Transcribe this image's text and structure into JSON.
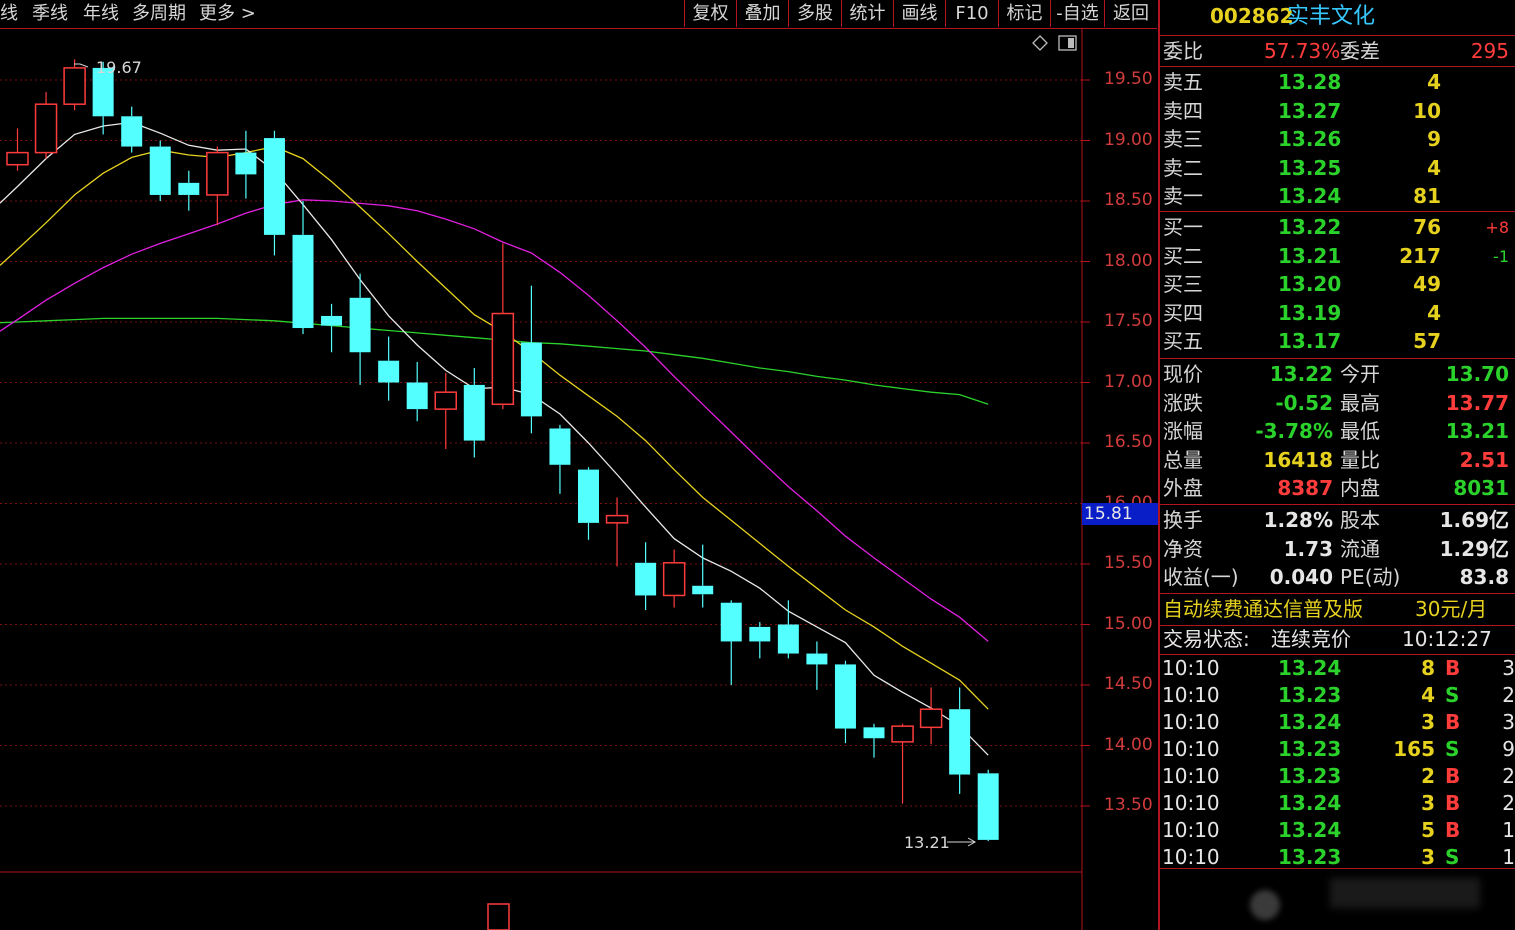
{
  "toolbar": {
    "period_tabs": [
      "线",
      "季线",
      "年线",
      "多周期",
      "更多"
    ],
    "more_arrow": ">",
    "buttons": [
      "复权",
      "叠加",
      "多股",
      "统计",
      "画线",
      "F10",
      "标记",
      "-自选",
      "返回"
    ]
  },
  "chart": {
    "y_ticks": [
      "19.50",
      "19.00",
      "18.50",
      "18.00",
      "17.50",
      "17.00",
      "16.50",
      "16.00",
      "15.50",
      "15.00",
      "14.50",
      "14.00",
      "13.50"
    ],
    "cursor_price": "15.81",
    "high_label": "19.67",
    "low_label": "13.21",
    "colors": {
      "up": "#ff3c3c",
      "down": "#54ffff",
      "ma5": "#e8e8e8",
      "ma10": "#e6d21e",
      "ma20": "#e020e0",
      "ma60": "#2bd22b",
      "grid": "#7a1010"
    },
    "candles": [
      {
        "o": 18.8,
        "c": 18.9,
        "h": 19.1,
        "l": 18.75
      },
      {
        "o": 18.9,
        "c": 19.3,
        "h": 19.4,
        "l": 18.85
      },
      {
        "o": 19.3,
        "c": 19.6,
        "h": 19.67,
        "l": 19.25
      },
      {
        "o": 19.6,
        "c": 19.2,
        "h": 19.65,
        "l": 19.05
      },
      {
        "o": 19.2,
        "c": 18.95,
        "h": 19.28,
        "l": 18.9
      },
      {
        "o": 18.95,
        "c": 18.55,
        "h": 19.0,
        "l": 18.5
      },
      {
        "o": 18.65,
        "c": 18.55,
        "h": 18.75,
        "l": 18.42
      },
      {
        "o": 18.55,
        "c": 18.9,
        "h": 18.95,
        "l": 18.3
      },
      {
        "o": 18.9,
        "c": 18.72,
        "h": 19.08,
        "l": 18.52
      },
      {
        "o": 19.02,
        "c": 18.22,
        "h": 19.08,
        "l": 18.05
      },
      {
        "o": 18.22,
        "c": 17.45,
        "h": 18.5,
        "l": 17.4
      },
      {
        "o": 17.55,
        "c": 17.47,
        "h": 17.65,
        "l": 17.25
      },
      {
        "o": 17.7,
        "c": 17.25,
        "h": 17.9,
        "l": 16.98
      },
      {
        "o": 17.18,
        "c": 17.0,
        "h": 17.38,
        "l": 16.85
      },
      {
        "o": 17.0,
        "c": 16.78,
        "h": 17.17,
        "l": 16.68
      },
      {
        "o": 16.78,
        "c": 16.92,
        "h": 17.08,
        "l": 16.45
      },
      {
        "o": 16.98,
        "c": 16.52,
        "h": 17.12,
        "l": 16.38
      },
      {
        "o": 16.82,
        "c": 17.57,
        "h": 18.15,
        "l": 16.78
      },
      {
        "o": 17.33,
        "c": 16.72,
        "h": 17.8,
        "l": 16.58
      },
      {
        "o": 16.62,
        "c": 16.32,
        "h": 16.65,
        "l": 16.08
      },
      {
        "o": 16.28,
        "c": 15.84,
        "h": 16.3,
        "l": 15.7
      },
      {
        "o": 15.84,
        "c": 15.9,
        "h": 16.05,
        "l": 15.48
      },
      {
        "o": 15.51,
        "c": 15.24,
        "h": 15.68,
        "l": 15.12
      },
      {
        "o": 15.24,
        "c": 15.51,
        "h": 15.62,
        "l": 15.14
      },
      {
        "o": 15.32,
        "c": 15.25,
        "h": 15.66,
        "l": 15.14
      },
      {
        "o": 15.18,
        "c": 14.86,
        "h": 15.2,
        "l": 14.5
      },
      {
        "o": 14.98,
        "c": 14.86,
        "h": 15.02,
        "l": 14.72
      },
      {
        "o": 15.0,
        "c": 14.76,
        "h": 15.2,
        "l": 14.72
      },
      {
        "o": 14.76,
        "c": 14.67,
        "h": 14.86,
        "l": 14.46
      },
      {
        "o": 14.67,
        "c": 14.14,
        "h": 14.7,
        "l": 14.02
      },
      {
        "o": 14.15,
        "c": 14.06,
        "h": 14.18,
        "l": 13.9
      },
      {
        "o": 14.03,
        "c": 14.16,
        "h": 14.18,
        "l": 13.52
      },
      {
        "o": 14.15,
        "c": 14.3,
        "h": 14.48,
        "l": 14.01
      },
      {
        "o": 14.3,
        "c": 13.76,
        "h": 14.48,
        "l": 13.6
      },
      {
        "o": 13.77,
        "c": 13.22,
        "h": 13.8,
        "l": 13.21
      }
    ],
    "ma5": [
      18.62,
      18.85,
      19.05,
      19.12,
      19.15,
      19.06,
      18.96,
      18.92,
      18.93,
      18.75,
      18.47,
      18.18,
      17.85,
      17.55,
      17.31,
      17.1,
      16.95,
      16.96,
      16.9,
      16.74,
      16.5,
      16.24,
      15.97,
      15.71,
      15.55,
      15.44,
      15.3,
      15.11,
      14.98,
      14.85,
      14.58,
      14.44,
      14.31,
      14.16,
      13.92
    ],
    "ma10": [
      18.1,
      18.32,
      18.55,
      18.73,
      18.86,
      18.92,
      18.88,
      18.86,
      18.9,
      18.95,
      18.85,
      18.66,
      18.45,
      18.23,
      18.0,
      17.78,
      17.56,
      17.42,
      17.25,
      17.06,
      16.89,
      16.72,
      16.52,
      16.28,
      16.05,
      15.86,
      15.67,
      15.48,
      15.3,
      15.12,
      14.98,
      14.82,
      14.68,
      14.54,
      14.3
    ],
    "ma20": [
      17.52,
      17.68,
      17.82,
      17.95,
      18.06,
      18.15,
      18.23,
      18.31,
      18.4,
      18.47,
      18.51,
      18.5,
      18.48,
      18.46,
      18.42,
      18.35,
      18.27,
      18.16,
      18.07,
      17.91,
      17.72,
      17.51,
      17.29,
      17.05,
      16.82,
      16.59,
      16.36,
      16.14,
      15.94,
      15.73,
      15.55,
      15.38,
      15.21,
      15.06,
      14.86
    ],
    "ma60": [
      17.5,
      17.51,
      17.52,
      17.53,
      17.53,
      17.53,
      17.53,
      17.53,
      17.52,
      17.51,
      17.49,
      17.47,
      17.45,
      17.43,
      17.41,
      17.39,
      17.37,
      17.35,
      17.33,
      17.32,
      17.3,
      17.28,
      17.26,
      17.23,
      17.2,
      17.16,
      17.12,
      17.09,
      17.05,
      17.02,
      16.98,
      16.95,
      16.92,
      16.9,
      16.82
    ]
  },
  "quote": {
    "code": "002862",
    "name": "实丰文化",
    "weibi_label": "委比",
    "weibi": "57.73%",
    "weicha_label": "委差",
    "weicha": "295",
    "asks": [
      {
        "label": "卖五",
        "price": "13.28",
        "vol": "4"
      },
      {
        "label": "卖四",
        "price": "13.27",
        "vol": "10"
      },
      {
        "label": "卖三",
        "price": "13.26",
        "vol": "9"
      },
      {
        "label": "卖二",
        "price": "13.25",
        "vol": "4"
      },
      {
        "label": "卖一",
        "price": "13.24",
        "vol": "81"
      }
    ],
    "bids": [
      {
        "label": "买一",
        "price": "13.22",
        "vol": "76",
        "chg": "+8"
      },
      {
        "label": "买二",
        "price": "13.21",
        "vol": "217",
        "chg": "-1"
      },
      {
        "label": "买三",
        "price": "13.20",
        "vol": "49",
        "chg": ""
      },
      {
        "label": "买四",
        "price": "13.19",
        "vol": "4",
        "chg": ""
      },
      {
        "label": "买五",
        "price": "13.17",
        "vol": "57",
        "chg": ""
      }
    ],
    "stats": [
      {
        "l1": "现价",
        "v1": "13.22",
        "c1": "g",
        "l2": "今开",
        "v2": "13.70",
        "c2": "g"
      },
      {
        "l1": "涨跌",
        "v1": "-0.52",
        "c1": "g",
        "l2": "最高",
        "v2": "13.77",
        "c2": "r"
      },
      {
        "l1": "涨幅",
        "v1": "-3.78%",
        "c1": "g",
        "l2": "最低",
        "v2": "13.21",
        "c2": "g"
      },
      {
        "l1": "总量",
        "v1": "16418",
        "c1": "y",
        "l2": "量比",
        "v2": "2.51",
        "c2": "r"
      },
      {
        "l1": "外盘",
        "v1": "8387",
        "c1": "r",
        "l2": "内盘",
        "v2": "8031",
        "c2": "g"
      }
    ],
    "info": [
      {
        "l1": "换手",
        "v1": "1.28%",
        "l2": "股本",
        "v2": "1.69亿"
      },
      {
        "l1": "净资",
        "v1": "1.73",
        "l2": "流通",
        "v2": "1.29亿"
      },
      {
        "l1": "收益(一)",
        "v1": "0.040",
        "l2": "PE(动)",
        "v2": "83.8"
      }
    ],
    "ad_text": "自动续费通达信普及版",
    "ad_price": "30元/月",
    "status_label": "交易状态:",
    "status_value": "连续竞价",
    "status_time": "10:12:27",
    "ticks": [
      {
        "t": "10:10",
        "p": "13.24",
        "v": "8",
        "bs": "B",
        "n": "3"
      },
      {
        "t": "10:10",
        "p": "13.23",
        "v": "4",
        "bs": "S",
        "n": "2"
      },
      {
        "t": "10:10",
        "p": "13.24",
        "v": "3",
        "bs": "B",
        "n": "3"
      },
      {
        "t": "10:10",
        "p": "13.23",
        "v": "165",
        "bs": "S",
        "n": "9"
      },
      {
        "t": "10:10",
        "p": "13.23",
        "v": "2",
        "bs": "B",
        "n": "2"
      },
      {
        "t": "10:10",
        "p": "13.24",
        "v": "3",
        "bs": "B",
        "n": "2"
      },
      {
        "t": "10:10",
        "p": "13.24",
        "v": "5",
        "bs": "B",
        "n": "1"
      },
      {
        "t": "10:10",
        "p": "13.23",
        "v": "3",
        "bs": "S",
        "n": "1"
      }
    ]
  }
}
